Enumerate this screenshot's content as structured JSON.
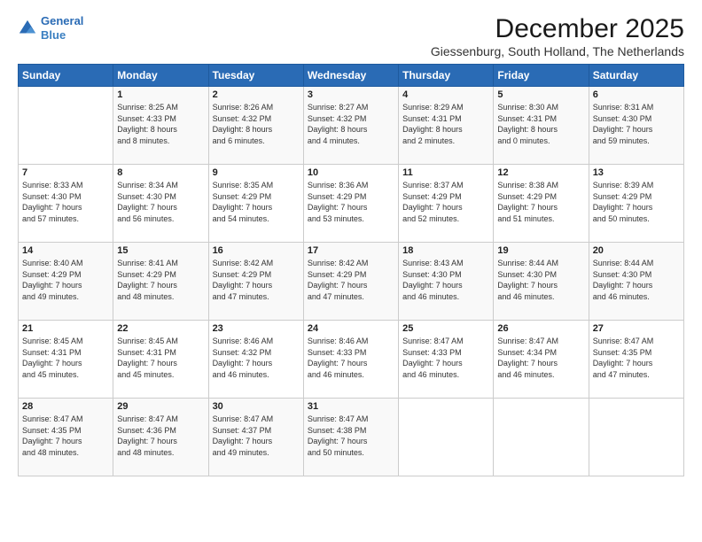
{
  "logo": {
    "line1": "General",
    "line2": "Blue"
  },
  "title": "December 2025",
  "location": "Giessenburg, South Holland, The Netherlands",
  "header_days": [
    "Sunday",
    "Monday",
    "Tuesday",
    "Wednesday",
    "Thursday",
    "Friday",
    "Saturday"
  ],
  "weeks": [
    [
      {
        "day": "",
        "text": ""
      },
      {
        "day": "1",
        "text": "Sunrise: 8:25 AM\nSunset: 4:33 PM\nDaylight: 8 hours\nand 8 minutes."
      },
      {
        "day": "2",
        "text": "Sunrise: 8:26 AM\nSunset: 4:32 PM\nDaylight: 8 hours\nand 6 minutes."
      },
      {
        "day": "3",
        "text": "Sunrise: 8:27 AM\nSunset: 4:32 PM\nDaylight: 8 hours\nand 4 minutes."
      },
      {
        "day": "4",
        "text": "Sunrise: 8:29 AM\nSunset: 4:31 PM\nDaylight: 8 hours\nand 2 minutes."
      },
      {
        "day": "5",
        "text": "Sunrise: 8:30 AM\nSunset: 4:31 PM\nDaylight: 8 hours\nand 0 minutes."
      },
      {
        "day": "6",
        "text": "Sunrise: 8:31 AM\nSunset: 4:30 PM\nDaylight: 7 hours\nand 59 minutes."
      }
    ],
    [
      {
        "day": "7",
        "text": "Sunrise: 8:33 AM\nSunset: 4:30 PM\nDaylight: 7 hours\nand 57 minutes."
      },
      {
        "day": "8",
        "text": "Sunrise: 8:34 AM\nSunset: 4:30 PM\nDaylight: 7 hours\nand 56 minutes."
      },
      {
        "day": "9",
        "text": "Sunrise: 8:35 AM\nSunset: 4:29 PM\nDaylight: 7 hours\nand 54 minutes."
      },
      {
        "day": "10",
        "text": "Sunrise: 8:36 AM\nSunset: 4:29 PM\nDaylight: 7 hours\nand 53 minutes."
      },
      {
        "day": "11",
        "text": "Sunrise: 8:37 AM\nSunset: 4:29 PM\nDaylight: 7 hours\nand 52 minutes."
      },
      {
        "day": "12",
        "text": "Sunrise: 8:38 AM\nSunset: 4:29 PM\nDaylight: 7 hours\nand 51 minutes."
      },
      {
        "day": "13",
        "text": "Sunrise: 8:39 AM\nSunset: 4:29 PM\nDaylight: 7 hours\nand 50 minutes."
      }
    ],
    [
      {
        "day": "14",
        "text": "Sunrise: 8:40 AM\nSunset: 4:29 PM\nDaylight: 7 hours\nand 49 minutes."
      },
      {
        "day": "15",
        "text": "Sunrise: 8:41 AM\nSunset: 4:29 PM\nDaylight: 7 hours\nand 48 minutes."
      },
      {
        "day": "16",
        "text": "Sunrise: 8:42 AM\nSunset: 4:29 PM\nDaylight: 7 hours\nand 47 minutes."
      },
      {
        "day": "17",
        "text": "Sunrise: 8:42 AM\nSunset: 4:29 PM\nDaylight: 7 hours\nand 47 minutes."
      },
      {
        "day": "18",
        "text": "Sunrise: 8:43 AM\nSunset: 4:30 PM\nDaylight: 7 hours\nand 46 minutes."
      },
      {
        "day": "19",
        "text": "Sunrise: 8:44 AM\nSunset: 4:30 PM\nDaylight: 7 hours\nand 46 minutes."
      },
      {
        "day": "20",
        "text": "Sunrise: 8:44 AM\nSunset: 4:30 PM\nDaylight: 7 hours\nand 46 minutes."
      }
    ],
    [
      {
        "day": "21",
        "text": "Sunrise: 8:45 AM\nSunset: 4:31 PM\nDaylight: 7 hours\nand 45 minutes."
      },
      {
        "day": "22",
        "text": "Sunrise: 8:45 AM\nSunset: 4:31 PM\nDaylight: 7 hours\nand 45 minutes."
      },
      {
        "day": "23",
        "text": "Sunrise: 8:46 AM\nSunset: 4:32 PM\nDaylight: 7 hours\nand 46 minutes."
      },
      {
        "day": "24",
        "text": "Sunrise: 8:46 AM\nSunset: 4:33 PM\nDaylight: 7 hours\nand 46 minutes."
      },
      {
        "day": "25",
        "text": "Sunrise: 8:47 AM\nSunset: 4:33 PM\nDaylight: 7 hours\nand 46 minutes."
      },
      {
        "day": "26",
        "text": "Sunrise: 8:47 AM\nSunset: 4:34 PM\nDaylight: 7 hours\nand 46 minutes."
      },
      {
        "day": "27",
        "text": "Sunrise: 8:47 AM\nSunset: 4:35 PM\nDaylight: 7 hours\nand 47 minutes."
      }
    ],
    [
      {
        "day": "28",
        "text": "Sunrise: 8:47 AM\nSunset: 4:35 PM\nDaylight: 7 hours\nand 48 minutes."
      },
      {
        "day": "29",
        "text": "Sunrise: 8:47 AM\nSunset: 4:36 PM\nDaylight: 7 hours\nand 48 minutes."
      },
      {
        "day": "30",
        "text": "Sunrise: 8:47 AM\nSunset: 4:37 PM\nDaylight: 7 hours\nand 49 minutes."
      },
      {
        "day": "31",
        "text": "Sunrise: 8:47 AM\nSunset: 4:38 PM\nDaylight: 7 hours\nand 50 minutes."
      },
      {
        "day": "",
        "text": ""
      },
      {
        "day": "",
        "text": ""
      },
      {
        "day": "",
        "text": ""
      }
    ]
  ]
}
